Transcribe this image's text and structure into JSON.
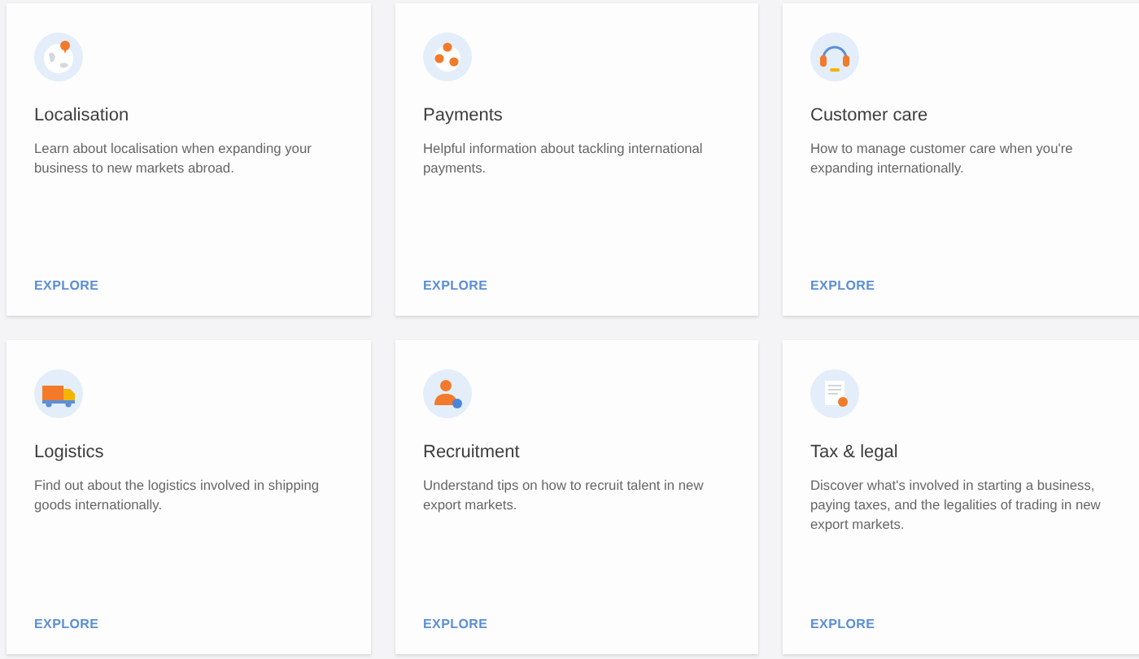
{
  "cards": [
    {
      "title": "Localisation",
      "description": "Learn about localisation when expanding your business to new markets abroad.",
      "link": "EXPLORE"
    },
    {
      "title": "Payments",
      "description": "Helpful information about tackling international payments.",
      "link": "EXPLORE"
    },
    {
      "title": "Customer care",
      "description": "How to manage customer care when you're expanding internationally.",
      "link": "EXPLORE"
    },
    {
      "title": "Logistics",
      "description": "Find out about the logistics involved in shipping goods internationally.",
      "link": "EXPLORE"
    },
    {
      "title": "Recruitment",
      "description": "Understand tips on how to recruit talent in new export markets.",
      "link": "EXPLORE"
    },
    {
      "title": "Tax & legal",
      "description": "Discover what's involved in starting a business, paying taxes, and the legalities of trading in new export markets.",
      "link": "EXPLORE"
    }
  ]
}
